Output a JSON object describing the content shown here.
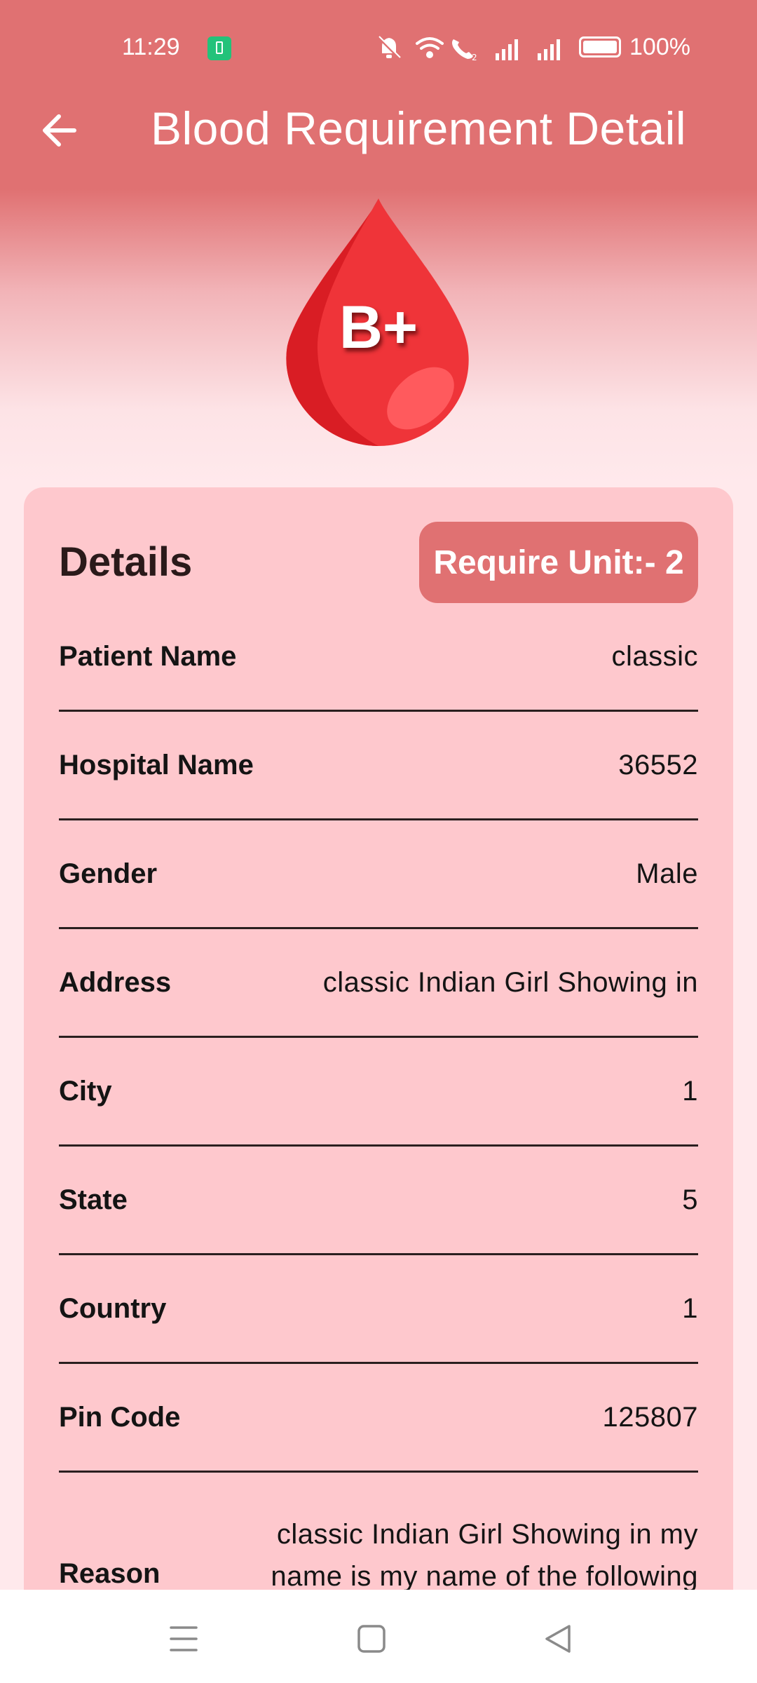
{
  "status_bar": {
    "time": "11:29",
    "battery_percent": "100%",
    "icons": [
      "battery-saver-icon",
      "mute-icon",
      "wifi-icon",
      "wifi-calling-icon",
      "signal-icon",
      "signal-icon",
      "battery-icon"
    ]
  },
  "app_bar": {
    "title": "Blood Requirement Detail",
    "back_icon": "arrow-left-icon"
  },
  "blood_group": {
    "label": "B+",
    "color": "#e8232b"
  },
  "details": {
    "title": "Details",
    "require_unit": "Require Unit:- 2",
    "rows": [
      {
        "label": "Patient Name",
        "value": "classic"
      },
      {
        "label": "Hospital Name",
        "value": "36552"
      },
      {
        "label": "Gender",
        "value": "Male"
      },
      {
        "label": "Address",
        "value": "classic Indian Girl Showing in"
      },
      {
        "label": "City",
        "value": "1"
      },
      {
        "label": "State",
        "value": "5"
      },
      {
        "label": "Country",
        "value": "1"
      },
      {
        "label": "Pin Code",
        "value": "125807"
      }
    ],
    "reason": {
      "label": "Reason",
      "value": "classic Indian Girl Showing in my name is my name of the following"
    }
  },
  "nav_bar": {
    "buttons": [
      "menu-icon",
      "home-icon",
      "back-triangle-icon"
    ]
  },
  "colors": {
    "primary": "#e07172",
    "card": "#fec8cd",
    "background": "#ffe9ec"
  }
}
